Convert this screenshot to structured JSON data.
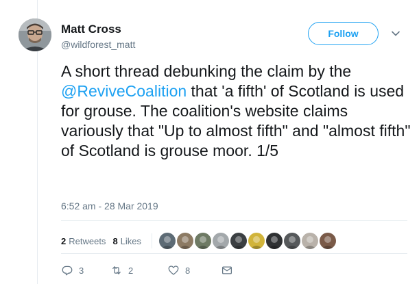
{
  "author": {
    "name": "Matt Cross",
    "handle": "@wildforest_matt"
  },
  "follow_button": "Follow",
  "tweet": {
    "text_before": "A short thread debunking the claim by the ",
    "mention": "@ReviveCoalition",
    "text_after": " that 'a fifth' of Scotland is used for grouse. The coalition's website claims variously that \"Up to almost fifth\" and \"almost fifth\" of Scotland is grouse moor.  1/5"
  },
  "timestamp": "6:52 am - 28 Mar 2019",
  "stats": {
    "retweets_count": "2",
    "retweets_label": "Retweets",
    "likes_count": "8",
    "likes_label": "Likes"
  },
  "likers": [
    {
      "icon": "liker-avatar-1",
      "color": "#5d6b75"
    },
    {
      "icon": "liker-avatar-2",
      "color": "#8c7a63"
    },
    {
      "icon": "liker-avatar-3",
      "color": "#6e7a64"
    },
    {
      "icon": "liker-avatar-4",
      "color": "#a3a8ab"
    },
    {
      "icon": "liker-avatar-5",
      "color": "#3b3f42"
    },
    {
      "icon": "liker-avatar-6",
      "color": "#d1b43a"
    },
    {
      "icon": "liker-avatar-7",
      "color": "#2f3133"
    },
    {
      "icon": "liker-avatar-8",
      "color": "#56595b"
    },
    {
      "icon": "liker-avatar-9",
      "color": "#b9b2aa"
    },
    {
      "icon": "liker-avatar-10",
      "color": "#7a5a48"
    }
  ],
  "actions": {
    "replies": "3",
    "retweets": "2",
    "likes": "8"
  },
  "colors": {
    "accent": "#1da1f2",
    "text": "#14171a",
    "secondary": "#657786",
    "divider": "#e6ecf0"
  }
}
